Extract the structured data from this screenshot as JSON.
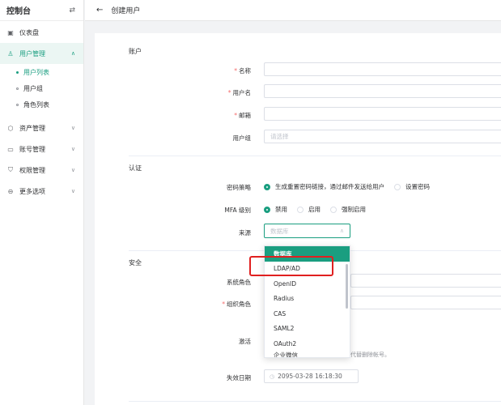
{
  "sidebar": {
    "title": "控制台",
    "swap_icon": "⇄",
    "items": [
      {
        "label": "仪表盘",
        "icon": "▣"
      },
      {
        "label": "用户管理",
        "icon": "♙",
        "expanded": true
      },
      {
        "label": "资产管理",
        "icon": "⬡"
      },
      {
        "label": "账号管理",
        "icon": "▭"
      },
      {
        "label": "权限管理",
        "icon": "⛉"
      },
      {
        "label": "更多选项",
        "icon": "⊖"
      }
    ],
    "sub_items": [
      {
        "label": "用户列表",
        "active": true
      },
      {
        "label": "用户组"
      },
      {
        "label": "角色列表"
      }
    ]
  },
  "header": {
    "back_icon": "←",
    "title": "创建用户"
  },
  "form": {
    "account_section": "账户",
    "name_label": "名称",
    "username_label": "用户名",
    "email_label": "邮箱",
    "group_label": "用户组",
    "group_placeholder": "请选择",
    "auth_section": "认证",
    "password_label": "密码策略",
    "password_opt1": "生成重置密码链接，通过邮件发送给用户",
    "password_opt2": "设置密码",
    "mfa_label": "MFA 级别",
    "mfa_opt1": "禁用",
    "mfa_opt2": "启用",
    "mfa_opt3": "强制启用",
    "source_label": "来源",
    "source_placeholder": "数据库",
    "security_section": "安全",
    "system_role_label": "系统角色",
    "org_role_label": "组织角色",
    "active_label": "激活",
    "hint_tail": "代替删除帐号。",
    "expire_label": "失效日期",
    "expire_value": "2095-03-28 16:18:30"
  },
  "dropdown": {
    "options": [
      "数据库",
      "LDAP/AD",
      "OpenID",
      "Radius",
      "CAS",
      "SAML2",
      "OAuth2",
      "企业微信"
    ]
  },
  "colors": {
    "accent": "#1a9e80",
    "highlight": "#e02020"
  }
}
